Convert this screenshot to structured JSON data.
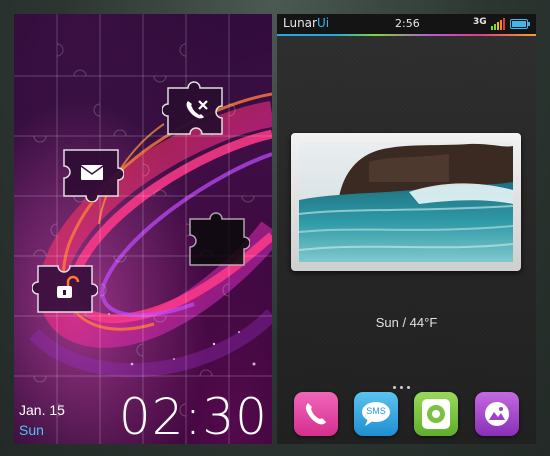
{
  "lock_screen": {
    "date": "Jan. 15",
    "day": "Sun",
    "time": "02:30",
    "pieces": [
      {
        "icon": "missed-call-icon"
      },
      {
        "icon": "envelope-icon"
      },
      {
        "icon": "unlock-icon"
      },
      {
        "icon": "empty-slot"
      }
    ]
  },
  "home_screen": {
    "status_bar": {
      "brand_main": "Lunar",
      "brand_accent": "Ui",
      "clock": "2:56",
      "network": "3G",
      "battery_icon": "battery-icon",
      "signal_icon": "signal-bars-icon"
    },
    "accent_color": "#3fb6e8",
    "photo_widget": {
      "subject": "ocean wave photo"
    },
    "weather": "Sun / 44°F",
    "dock": [
      {
        "name": "phone",
        "icon": "phone-icon",
        "color": "#e040a0"
      },
      {
        "name": "sms",
        "icon": "sms-bubble-icon",
        "label": "SMS",
        "color": "#2ea7e0"
      },
      {
        "name": "music",
        "icon": "music-player-icon",
        "color": "#7cc242"
      },
      {
        "name": "gallery",
        "icon": "gallery-icon",
        "color": "#a040c8"
      }
    ]
  }
}
